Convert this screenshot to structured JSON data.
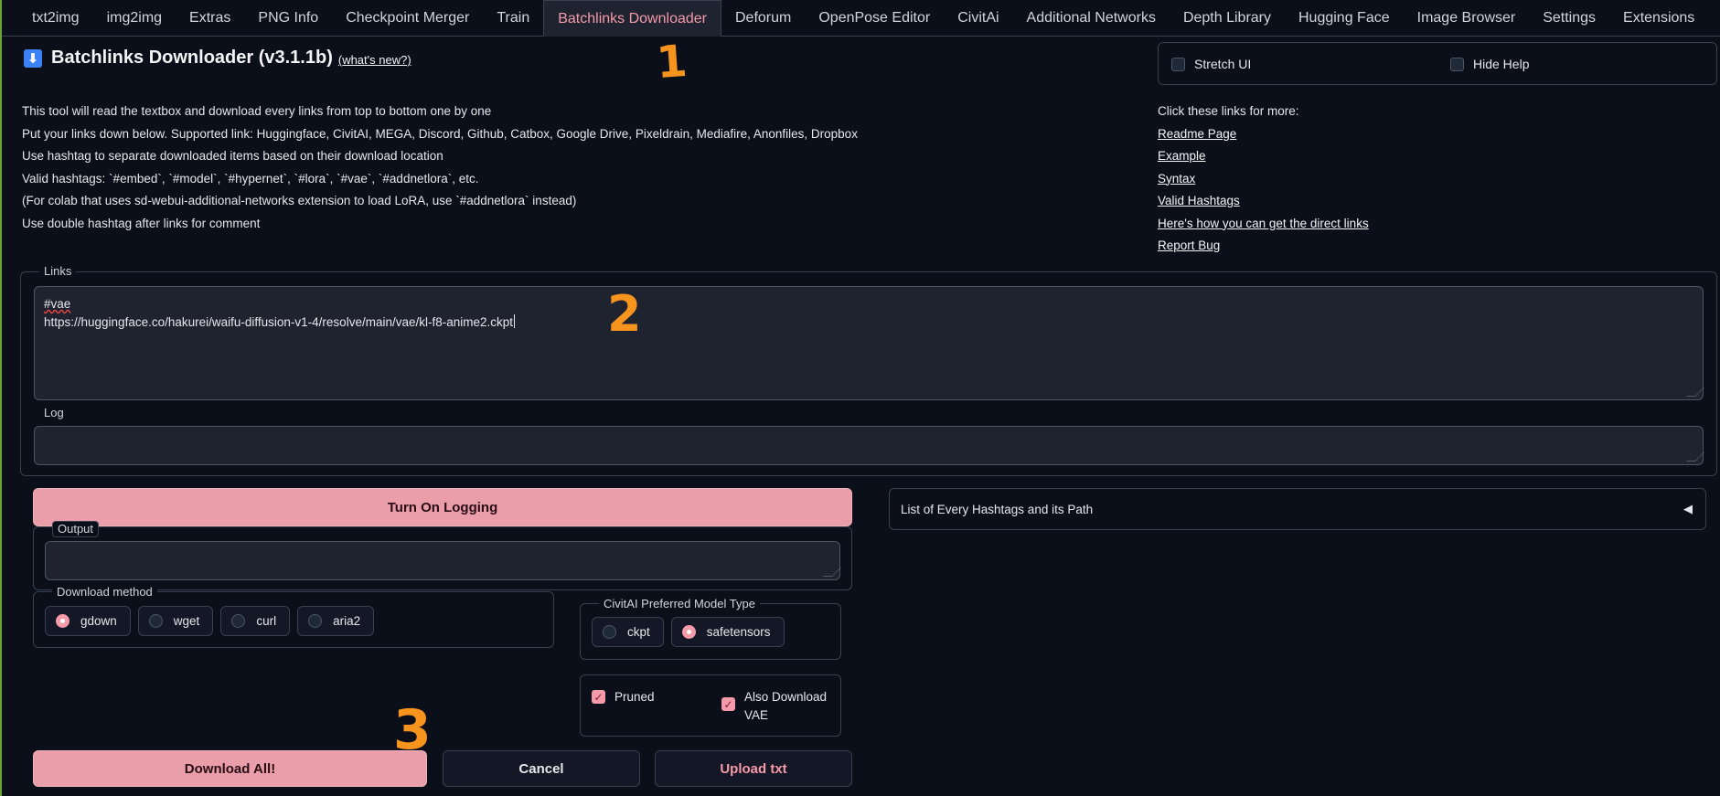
{
  "tabs": [
    {
      "label": "txt2img"
    },
    {
      "label": "img2img"
    },
    {
      "label": "Extras"
    },
    {
      "label": "PNG Info"
    },
    {
      "label": "Checkpoint Merger"
    },
    {
      "label": "Train"
    },
    {
      "label": "Batchlinks Downloader",
      "active": true
    },
    {
      "label": "Deforum"
    },
    {
      "label": "OpenPose Editor"
    },
    {
      "label": "CivitAi"
    },
    {
      "label": "Additional Networks"
    },
    {
      "label": "Depth Library"
    },
    {
      "label": "Hugging Face"
    },
    {
      "label": "Image Browser"
    },
    {
      "label": "Settings"
    },
    {
      "label": "Extensions"
    }
  ],
  "header": {
    "icon": "⬇",
    "title": "Batchlinks Downloader (v3.1.1b)",
    "whats_new": "(what's new?)"
  },
  "description": [
    "This tool will read the textbox and download every links from top to bottom one by one",
    "Put your links down below. Supported link: Huggingface, CivitAI, MEGA, Discord, Github, Catbox, Google Drive, Pixeldrain, Mediafire, Anonfiles, Dropbox",
    "Use hashtag to separate downloaded items based on their download location",
    "Valid hashtags: `#embed`, `#model`, `#hypernet`, `#lora`, `#vae`, `#addnetlora`, etc.",
    "(For colab that uses sd-webui-additional-networks extension to load LoRA, use `#addnetlora` instead)",
    "Use double hashtag after links for comment"
  ],
  "toggles": {
    "stretch_ui": "Stretch UI",
    "hide_help": "Hide Help"
  },
  "help_links": {
    "intro": "Click these links for more:",
    "items": [
      "Readme Page",
      "Example",
      "Syntax",
      "Valid Hashtags",
      "Here's how you can get the direct links",
      "Report Bug"
    ]
  },
  "links_box": {
    "label": "Links",
    "line1": "#vae",
    "line2": "https://huggingface.co/hakurei/waifu-diffusion-v1-4/resolve/main/vae/kl-f8-anime2.ckpt"
  },
  "log_box": {
    "label": "Log",
    "value": ""
  },
  "logging_button": "Turn On Logging",
  "output_box": {
    "label": "Output",
    "value": ""
  },
  "accordion": {
    "label": "List of Every Hashtags and its Path",
    "arrow": "◀"
  },
  "download_method": {
    "label": "Download method",
    "options": [
      "gdown",
      "wget",
      "curl",
      "aria2"
    ],
    "selected": "gdown"
  },
  "civitai_type": {
    "label": "CivitAI Preferred Model Type",
    "options": [
      "ckpt",
      "safetensors"
    ],
    "selected": "safetensors"
  },
  "checks": {
    "pruned": "Pruned",
    "vae_line1": "Also Download",
    "vae_line2": "VAE"
  },
  "actions": {
    "download_all": "Download All!",
    "cancel": "Cancel",
    "upload": "Upload txt"
  },
  "annotations": [
    "1",
    "2",
    "3"
  ],
  "colors": {
    "accent": "#f59aa8",
    "annotation": "#f7941d",
    "background": "#0b0f19"
  }
}
